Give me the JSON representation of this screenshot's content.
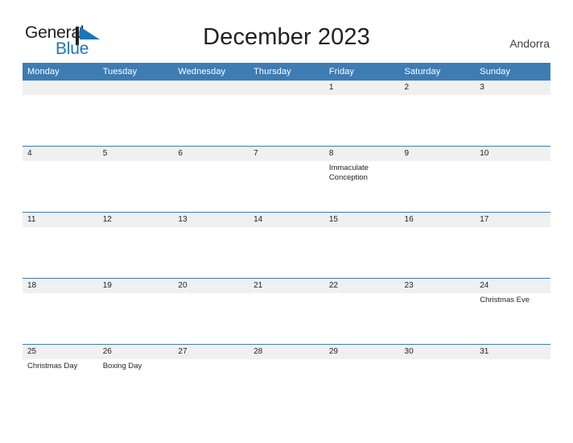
{
  "brand": {
    "name_part1": "General",
    "name_part2": "Blue",
    "mark": "triangle-flag-icon",
    "accent_color": "#1c75bc"
  },
  "header": {
    "title": "December 2023",
    "region": "Andorra",
    "header_bg_color": "#3e7cb4",
    "daynum_band_color": "#f0f0f0"
  },
  "calendar": {
    "month": "December",
    "year": "2023",
    "weekday_headers": [
      "Monday",
      "Tuesday",
      "Wednesday",
      "Thursday",
      "Friday",
      "Saturday",
      "Sunday"
    ],
    "weeks": [
      [
        {
          "day": "",
          "events": []
        },
        {
          "day": "",
          "events": []
        },
        {
          "day": "",
          "events": []
        },
        {
          "day": "",
          "events": []
        },
        {
          "day": "1",
          "events": []
        },
        {
          "day": "2",
          "events": []
        },
        {
          "day": "3",
          "events": []
        }
      ],
      [
        {
          "day": "4",
          "events": []
        },
        {
          "day": "5",
          "events": []
        },
        {
          "day": "6",
          "events": []
        },
        {
          "day": "7",
          "events": []
        },
        {
          "day": "8",
          "events": [
            "Immaculate Conception"
          ]
        },
        {
          "day": "9",
          "events": []
        },
        {
          "day": "10",
          "events": []
        }
      ],
      [
        {
          "day": "11",
          "events": []
        },
        {
          "day": "12",
          "events": []
        },
        {
          "day": "13",
          "events": []
        },
        {
          "day": "14",
          "events": []
        },
        {
          "day": "15",
          "events": []
        },
        {
          "day": "16",
          "events": []
        },
        {
          "day": "17",
          "events": []
        }
      ],
      [
        {
          "day": "18",
          "events": []
        },
        {
          "day": "19",
          "events": []
        },
        {
          "day": "20",
          "events": []
        },
        {
          "day": "21",
          "events": []
        },
        {
          "day": "22",
          "events": []
        },
        {
          "day": "23",
          "events": []
        },
        {
          "day": "24",
          "events": [
            "Christmas Eve"
          ]
        }
      ],
      [
        {
          "day": "25",
          "events": [
            "Christmas Day"
          ]
        },
        {
          "day": "26",
          "events": [
            "Boxing Day"
          ]
        },
        {
          "day": "27",
          "events": []
        },
        {
          "day": "28",
          "events": []
        },
        {
          "day": "29",
          "events": []
        },
        {
          "day": "30",
          "events": []
        },
        {
          "day": "31",
          "events": []
        }
      ]
    ]
  }
}
